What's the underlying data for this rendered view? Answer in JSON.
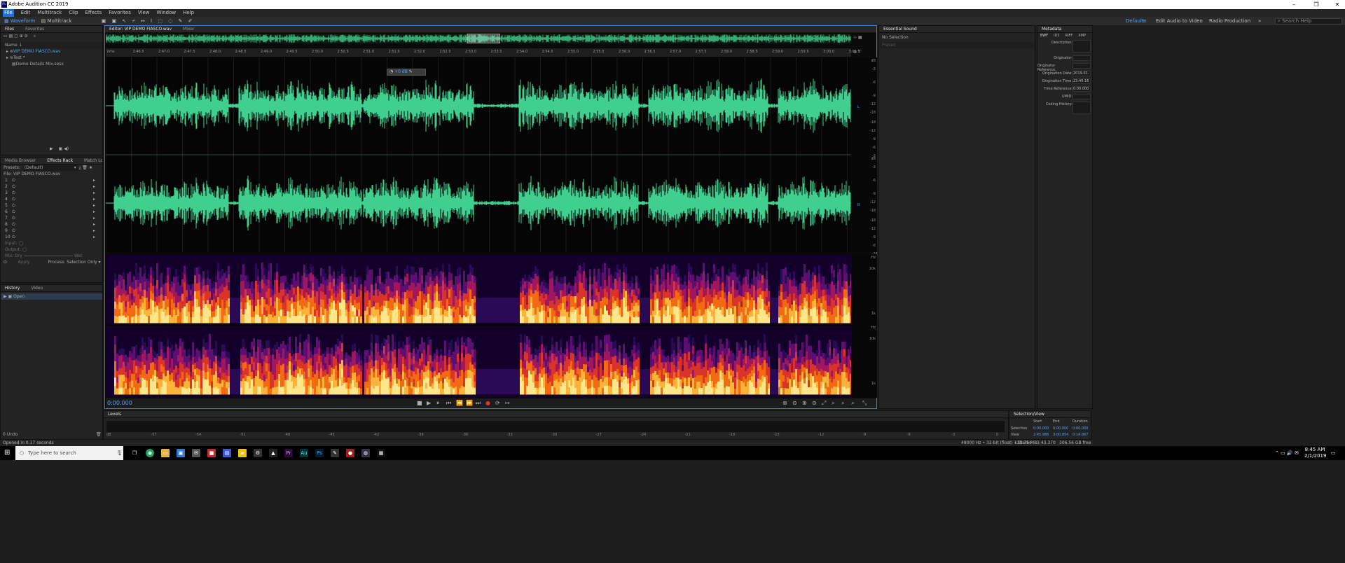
{
  "window": {
    "title": "Adobe Audition CC 2019",
    "minimize": "–",
    "maximize": "❐",
    "close": "✕"
  },
  "menu": [
    "File",
    "Edit",
    "Multitrack",
    "Clip",
    "Effects",
    "Favorites",
    "View",
    "Window",
    "Help"
  ],
  "toolbar": {
    "waveform_label": "Waveform",
    "multitrack_label": "Multitrack",
    "workspaces": [
      "Default",
      "Edit Audio to Video",
      "Radio Production"
    ],
    "search_placeholder": "Search Help"
  },
  "files_panel": {
    "tabs": [
      "Files",
      "Favorites"
    ],
    "column_header": "Name ↓",
    "items": [
      "VIP DEMO FIASCO.wav",
      "Test *",
      "Demo Details Mix.sesx"
    ]
  },
  "effects_panel": {
    "tabs": [
      "Media Browser",
      "Effects Rack",
      "Match Loud"
    ],
    "presets_label": "Presets:",
    "presets_value": "(Default)",
    "file_label": "File: VIP DEMO FIASCO.wav",
    "slots": [
      "1",
      "2",
      "3",
      "4",
      "5",
      "6",
      "7",
      "8",
      "9",
      "10"
    ],
    "input_label": "Input:",
    "output_label": "Output:",
    "mix_label": "Mix:",
    "dry_label": "Dry",
    "wet_label": "Wet",
    "process_label": "Process:",
    "process_value": "Selection Only",
    "apply_label": "Apply"
  },
  "history_panel": {
    "tabs": [
      "History",
      "Video"
    ],
    "items": [
      "Open"
    ],
    "undo_count": "0 Undo"
  },
  "editor": {
    "tabs": [
      "Editor: VIP DEMO FIASCO.wav",
      "Mixer"
    ],
    "ruler_labels": [
      "hms",
      "2:46.5",
      "2:47.0",
      "2:47.5",
      "2:48.0",
      "2:48.5",
      "2:49.0",
      "2:49.5",
      "2:50.0",
      "2:50.5",
      "2:51.0",
      "2:51.5",
      "2:52.0",
      "2:52.5",
      "2:53.0",
      "2:53.5",
      "2:54.0",
      "2:54.5",
      "2:55.0",
      "2:55.5",
      "2:56.0",
      "2:56.5",
      "2:57.0",
      "2:57.5",
      "2:58.0",
      "2:58.5",
      "2:59.0",
      "2:59.5",
      "3:00.0",
      "3:00.5"
    ],
    "hud_value": "+0 dB",
    "db_labels": [
      "dB",
      "-3",
      "-6",
      "-9",
      "-12",
      "-18",
      "-18",
      "-12",
      "-9",
      "-6",
      "-3"
    ],
    "spec_labels": [
      "Hz",
      "10k",
      "1k"
    ],
    "channel_markers": [
      "L",
      "R"
    ],
    "current_time": "0:00.000"
  },
  "essential_sound": {
    "title": "Essential Sound",
    "subtitle": "No Selection",
    "preset_label": "Preset:"
  },
  "metadata": {
    "title": "Metadata",
    "tabs": [
      "BWF",
      "ID3",
      "RIFF",
      "XMP"
    ],
    "fields": [
      {
        "label": "Description:",
        "value": ""
      },
      {
        "label": "Originator:",
        "value": ""
      },
      {
        "label": "Originator Reference:",
        "value": ""
      },
      {
        "label": "Origination Date:",
        "value": "2019-01-27"
      },
      {
        "label": "Origination Time:",
        "value": "23:40:16"
      },
      {
        "label": "Time Reference:",
        "value": "0:00.000"
      },
      {
        "label": "UMID:",
        "value": ""
      },
      {
        "label": "Coding History:",
        "value": ""
      }
    ]
  },
  "levels": {
    "title": "Levels",
    "scale": [
      "dB",
      "-57",
      "-54",
      "-51",
      "-48",
      "-45",
      "-42",
      "-39",
      "-36",
      "-33",
      "-30",
      "-27",
      "-24",
      "-21",
      "-18",
      "-15",
      "-12",
      "-9",
      "-6",
      "-3",
      "0"
    ]
  },
  "selection_view": {
    "title": "Selection/View",
    "headers": [
      "Start",
      "End",
      "Duration"
    ],
    "selection_label": "Selection",
    "view_label": "View",
    "selection": [
      "0:00.000",
      "0:00.000",
      "0:00.000"
    ],
    "view": [
      "2:45.986",
      "3:00.854",
      "0:14.867"
    ]
  },
  "status": {
    "left": "Opened in 0.17 seconds",
    "format": "48000 Hz • 32-bit (float) • Stereo",
    "size": "125.75 MB",
    "duration": "3:43.370",
    "free": "306.56 GB free"
  },
  "taskbar": {
    "search_placeholder": "Type here to search",
    "time": "8:45 AM",
    "date": "2/1/2019"
  },
  "colors": {
    "accent": "#1473e6",
    "waveform": "#40cf8e",
    "background": "#1d1d1d",
    "panel": "#232323"
  }
}
